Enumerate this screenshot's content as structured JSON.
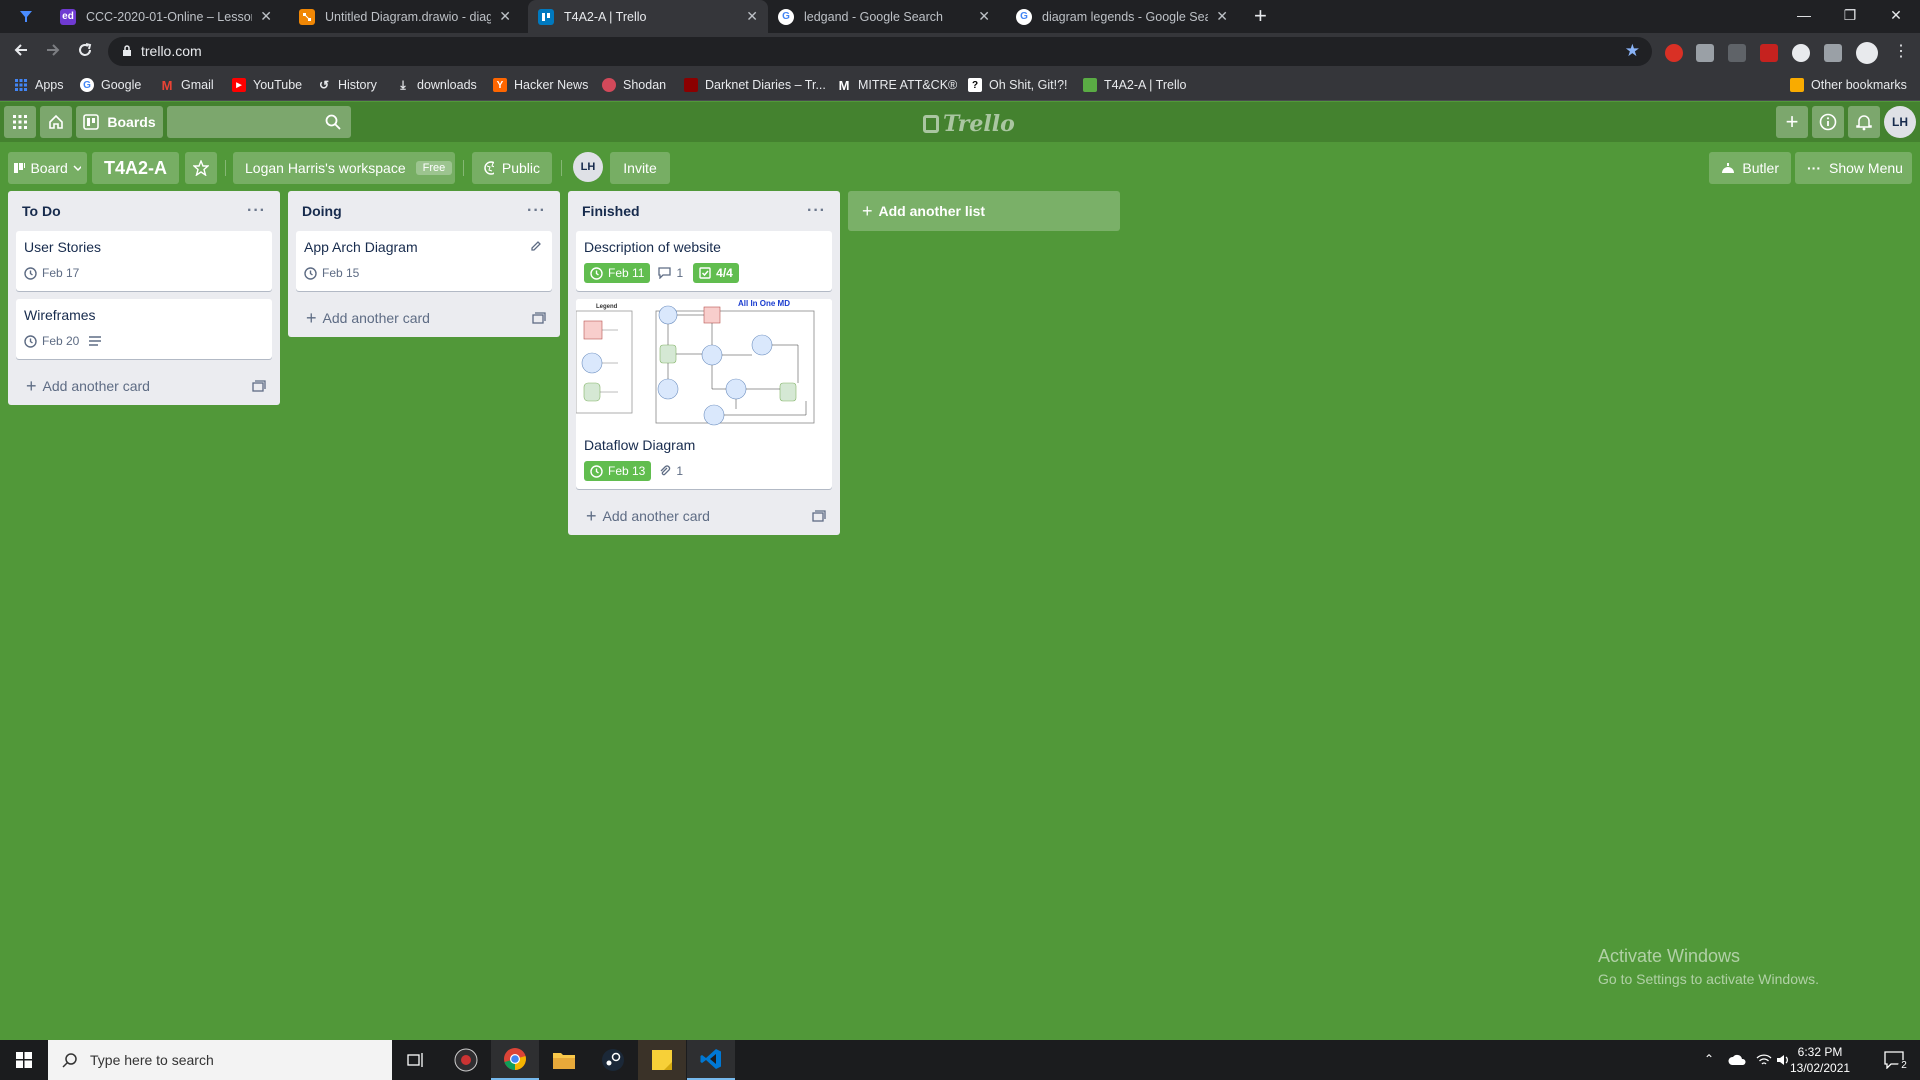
{
  "browser": {
    "tabs": [
      {
        "title": "CCC-2020-01-Online – Lessons",
        "fav": "ed",
        "color": "#6f3ad2"
      },
      {
        "title": "Untitled Diagram.drawio - diagra",
        "fav": "",
        "color": "#f08705"
      },
      {
        "title": "T4A2-A | Trello",
        "fav": "",
        "color": "#0079bf"
      },
      {
        "title": "ledgand - Google Search",
        "fav": "G",
        "color": "#ffffff"
      },
      {
        "title": "diagram legends - Google Search",
        "fav": "G",
        "color": "#ffffff"
      }
    ],
    "url": "trello.com",
    "bookmarks": [
      "Apps",
      "Google",
      "Gmail",
      "YouTube",
      "History",
      "downloads",
      "Hacker News",
      "Shodan",
      "Darknet Diaries – Tr...",
      "MITRE ATT&CK®",
      "Oh Shit, Git!?!",
      "T4A2-A | Trello"
    ],
    "other_bookmarks": "Other bookmarks"
  },
  "trello": {
    "header": {
      "boards_label": "Boards",
      "logo": "Trello",
      "avatar_initials": "LH"
    },
    "board": {
      "view_label": "Board",
      "title": "T4A2-A",
      "workspace": "Logan Harris's workspace",
      "workspace_tier": "Free",
      "visibility": "Public",
      "member_initials": "LH",
      "invite_label": "Invite",
      "butler_label": "Butler",
      "show_menu_label": "Show Menu"
    },
    "lists": [
      {
        "name": "To Do",
        "cards": [
          {
            "title": "User Stories",
            "due": "Feb 17"
          },
          {
            "title": "Wireframes",
            "due": "Feb 20"
          }
        ],
        "add_card": "Add another card"
      },
      {
        "name": "Doing",
        "cards": [
          {
            "title": "App Arch Diagram",
            "due": "Feb 15"
          }
        ],
        "add_card": "Add another card"
      },
      {
        "name": "Finished",
        "cards": [
          {
            "title": "Description of website",
            "due": "Feb 11",
            "comments": "1",
            "checklist": "4/4"
          },
          {
            "title": "Dataflow Diagram",
            "due": "Feb 13",
            "attachments": "1",
            "cover_title": "All In One MD",
            "cover_legend": "Legend"
          }
        ],
        "add_card": "Add another card"
      }
    ],
    "add_list": "Add another list"
  },
  "watermark": {
    "line1": "Activate Windows",
    "line2": "Go to Settings to activate Windows."
  },
  "taskbar": {
    "search_placeholder": "Type here to search",
    "time": "6:32 PM",
    "date": "13/02/2021",
    "notification_count": "2"
  }
}
